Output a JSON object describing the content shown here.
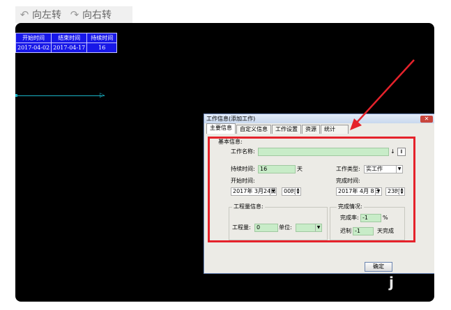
{
  "toolbar": {
    "rotate_left": "向左转",
    "rotate_right": "向右转"
  },
  "gantt": {
    "headers": [
      "开始时间",
      "结束时间",
      "持续时间"
    ],
    "row": [
      "2017-04-02",
      "2017-04-17",
      "16"
    ]
  },
  "dialog": {
    "title": "工作信息(添加工作)",
    "close": "✕",
    "tabs": [
      "主要信息",
      "自定义信息",
      "工作设置",
      "资源",
      "统计"
    ],
    "basic_info": "基本信息:",
    "work_name_label": "工作名称:",
    "work_name_value": "",
    "duration_label": "持续时间:",
    "duration_value": "16",
    "duration_unit": "天",
    "work_type_label": "工作类型:",
    "work_type_value": "实工作",
    "start_label": "开始时间:",
    "start_date": "2017年 3月24日",
    "start_hour": "00时",
    "finish_label": "完成时间:",
    "finish_date": "2017年 4月 8日",
    "finish_hour": "23时",
    "workload_group": "工程量信息:",
    "workload_label": "工程量:",
    "workload_value": "0",
    "unit_label": "单位:",
    "unit_value": "",
    "completion_group": "完成情况:",
    "rate_label": "完成率:",
    "rate_value": "-1",
    "rate_unit": "%",
    "delay_label": "迟制",
    "delay_value": "-1",
    "delay_unit": "天完成",
    "ok_button": "确定"
  },
  "colors": {
    "highlight": "#e5222b",
    "gantt_cell": "#1818e8",
    "gantt_line": "#19b5c8",
    "input_green": "#c8ecc8"
  }
}
